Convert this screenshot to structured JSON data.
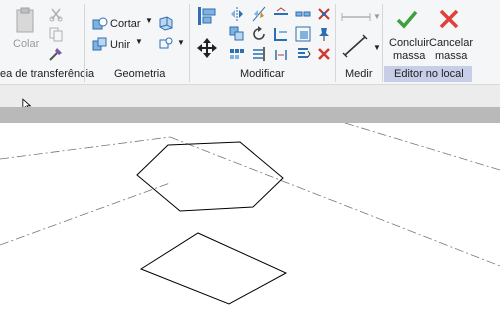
{
  "ribbon": {
    "clipboard": {
      "paste_label": "Colar",
      "panel_label": "ea de transferência"
    },
    "geometry": {
      "cut_label": "Cortar",
      "join_label": "Unir",
      "panel_label": "Geometria"
    },
    "modify": {
      "panel_label": "Modificar"
    },
    "measure": {
      "panel_label": "Medir"
    },
    "inplace": {
      "finish_label_1": "Concluir",
      "finish_label_2": "massa",
      "cancel_label_1": "Cancelar",
      "cancel_label_2": "massa",
      "panel_label": "Editor no local"
    }
  },
  "colors": {
    "accept": "#3ea03e",
    "cancel": "#e0403a",
    "context_tab": "#c8cde8"
  }
}
